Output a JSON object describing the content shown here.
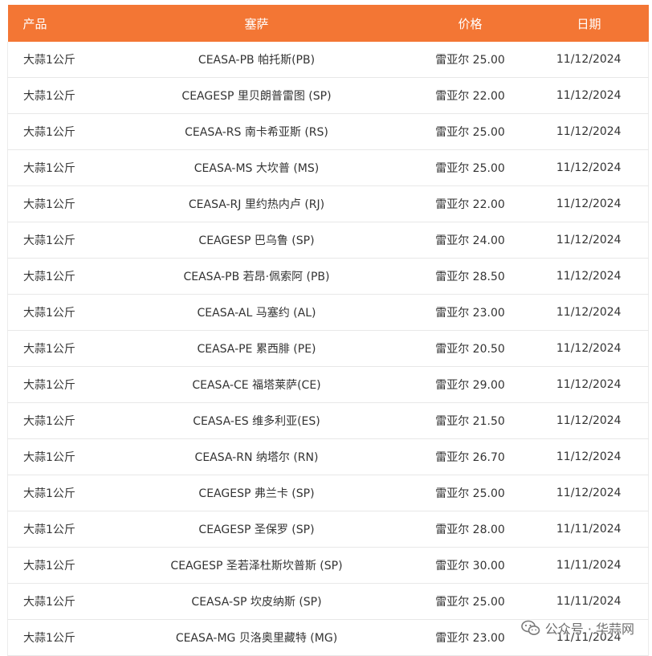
{
  "table": {
    "headers": {
      "product": "产品",
      "market": "塞萨",
      "price": "价格",
      "date": "日期"
    },
    "rows": [
      {
        "product": "大蒜1公斤",
        "market": "CEASA-PB 帕托斯(PB)",
        "price": "雷亚尔 25.00",
        "date": "11/12/2024"
      },
      {
        "product": "大蒜1公斤",
        "market": "CEAGESP 里贝朗普雷图 (SP)",
        "price": "雷亚尔 22.00",
        "date": "11/12/2024"
      },
      {
        "product": "大蒜1公斤",
        "market": "CEASA-RS 南卡希亚斯 (RS)",
        "price": "雷亚尔 25.00",
        "date": "11/12/2024"
      },
      {
        "product": "大蒜1公斤",
        "market": "CEASA-MS 大坎普 (MS)",
        "price": "雷亚尔 25.00",
        "date": "11/12/2024"
      },
      {
        "product": "大蒜1公斤",
        "market": "CEASA-RJ 里约热内卢 (RJ)",
        "price": "雷亚尔 22.00",
        "date": "11/12/2024"
      },
      {
        "product": "大蒜1公斤",
        "market": "CEAGESP 巴乌鲁 (SP)",
        "price": "雷亚尔 24.00",
        "date": "11/12/2024"
      },
      {
        "product": "大蒜1公斤",
        "market": "CEASA-PB 若昂·佩索阿 (PB)",
        "price": "雷亚尔 28.50",
        "date": "11/12/2024"
      },
      {
        "product": "大蒜1公斤",
        "market": "CEASA-AL 马塞约 (AL)",
        "price": "雷亚尔 23.00",
        "date": "11/12/2024"
      },
      {
        "product": "大蒜1公斤",
        "market": "CEASA-PE 累西腓 (PE)",
        "price": "雷亚尔 20.50",
        "date": "11/12/2024"
      },
      {
        "product": "大蒜1公斤",
        "market": "CEASA-CE 福塔莱萨(CE)",
        "price": "雷亚尔 29.00",
        "date": "11/12/2024"
      },
      {
        "product": "大蒜1公斤",
        "market": "CEASA-ES 维多利亚(ES)",
        "price": "雷亚尔 21.50",
        "date": "11/12/2024"
      },
      {
        "product": "大蒜1公斤",
        "market": "CEASA-RN 纳塔尔 (RN)",
        "price": "雷亚尔 26.70",
        "date": "11/12/2024"
      },
      {
        "product": "大蒜1公斤",
        "market": "CEAGESP 弗兰卡 (SP)",
        "price": "雷亚尔 25.00",
        "date": "11/12/2024"
      },
      {
        "product": "大蒜1公斤",
        "market": "CEAGESP 圣保罗 (SP)",
        "price": "雷亚尔 28.00",
        "date": "11/11/2024"
      },
      {
        "product": "大蒜1公斤",
        "market": "CEAGESP 圣若泽杜斯坎普斯 (SP)",
        "price": "雷亚尔 30.00",
        "date": "11/11/2024"
      },
      {
        "product": "大蒜1公斤",
        "market": "CEASA-SP 坎皮纳斯 (SP)",
        "price": "雷亚尔 25.00",
        "date": "11/11/2024"
      },
      {
        "product": "大蒜1公斤",
        "market": "CEASA-MG 贝洛奥里藏特 (MG)",
        "price": "雷亚尔 23.00",
        "date": "11/11/2024"
      }
    ]
  },
  "watermark": {
    "text": "公众号 · 华蒜网",
    "icon": "wechat-icon"
  },
  "colors": {
    "header_bg": "#f37634",
    "header_text": "#ffffff",
    "cell_text": "#333333",
    "row_border": "#e8e8e8"
  }
}
